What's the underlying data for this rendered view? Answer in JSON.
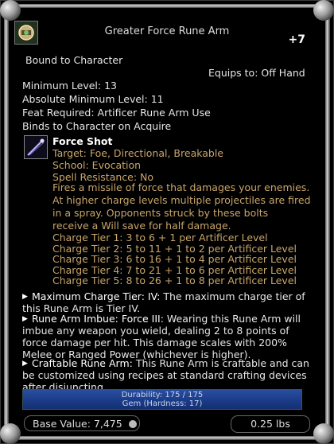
{
  "item": {
    "name": "Greater Force Rune Arm",
    "enhancement": "+7",
    "icon": "rune-arm-icon",
    "bound": "Bound to Character",
    "equips_to": "Equips to: Off Hand",
    "min_level": "Minimum Level: 13",
    "abs_min_level": "Absolute Minimum Level: 11",
    "feat_required": "Feat Required: Artificer Rune Arm Use",
    "binds": "Binds to Character on Acquire"
  },
  "spell": {
    "icon": "force-shot-icon",
    "name": "Force Shot",
    "target": "Target: Foe, Directional, Breakable",
    "school": "School: Evocation",
    "resistance": "Spell Resistance: No",
    "description": [
      "Fires a missile of force that damages your enemies.",
      " At higher charge levels multiple projectiles are fired",
      " in a spray. Opponents struck by these bolts",
      " receive a Will save for half damage."
    ],
    "tiers": [
      "Charge Tier 1: 3 to 6 + 1 per Artificer Level",
      "Charge Tier 2: 5 to 11 + 1 to 2 per Artificer Level",
      "Charge Tier 3: 6 to 16 + 1 to 4 per Artificer Level",
      "Charge Tier 4: 7 to 21 + 1 to 6 per Artificer Level",
      "Charge Tier 5: 8 to 26 + 1 to 8 per Artificer Level"
    ]
  },
  "effects": [
    {
      "heading": "Maximum Charge Tier: IV:",
      "lines": [
        " The maximum charge tier of",
        "this Rune Arm is Tier IV."
      ]
    },
    {
      "heading": "Rune Arm Imbue: Force III:",
      "lines": [
        " Wearing this Rune Arm will",
        "imbue any weapon you wield, dealing 2 to 8 points of",
        "force damage per hit. This damage scales with 200%",
        "Melee or Ranged Power (whichever is higher)."
      ]
    },
    {
      "heading": "Craftable Rune Arm:",
      "lines": [
        " This Rune Arm is craftable and can",
        "be customized using recipes at standard crafting devices",
        "after disjuncting."
      ]
    }
  ],
  "durability": {
    "text": "Durability: 175 / 175",
    "material": "Gem (Hardness: 17)",
    "fraction": 1.0
  },
  "footer": {
    "base_value": "Base Value: 7,475",
    "coin_icon": "coin-icon",
    "weight": "0.25 lbs"
  },
  "colors": {
    "spell_text": "#c9a56a",
    "durability_bar": "#1a3a86"
  }
}
